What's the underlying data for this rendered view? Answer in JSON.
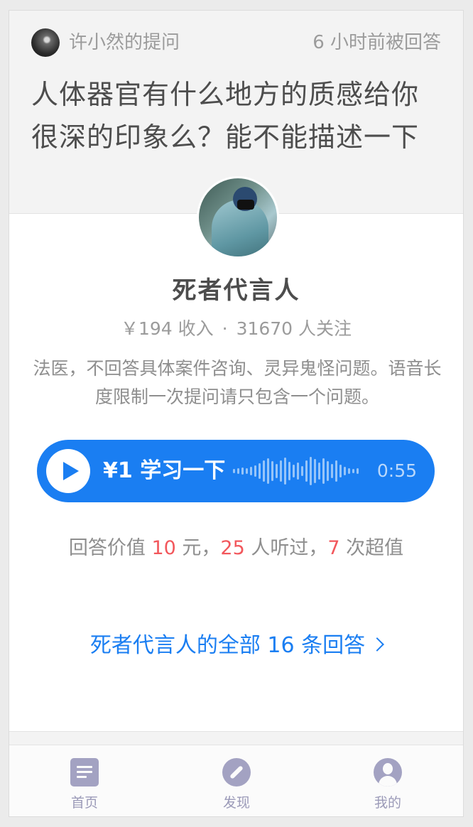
{
  "question": {
    "asker": "许小然的提问",
    "answered_time": "6 小时前被回答",
    "text": "人体器官有什么地方的质感给你很深的印象么？能不能描述一下"
  },
  "answerer": {
    "name": "死者代言人",
    "income": "￥194 收入",
    "separator": "·",
    "followers": "31670 人关注",
    "bio": "法医，不回答具体案件咨询、灵异鬼怪问题。语音长度限制一次提问请只包含一个问题。"
  },
  "audio": {
    "label": "¥1 学习一下",
    "duration": "0:55",
    "icon": "play-icon"
  },
  "value_line": {
    "prefix": "回答价值",
    "value": "10",
    "value_unit": "元，",
    "listeners": "25",
    "listeners_unit": "人听过，",
    "super": "7",
    "super_unit": "次超值"
  },
  "all_answers_link": "死者代言人的全部 16 条回答",
  "tabbar": {
    "tabs": [
      {
        "label": "首页",
        "icon": "home-icon"
      },
      {
        "label": "发现",
        "icon": "compass-icon"
      },
      {
        "label": "我的",
        "icon": "profile-icon"
      }
    ]
  },
  "colors": {
    "accent": "#1a7ef2",
    "highlight": "#f2575c",
    "tab_icon": "#a3a2c2"
  }
}
